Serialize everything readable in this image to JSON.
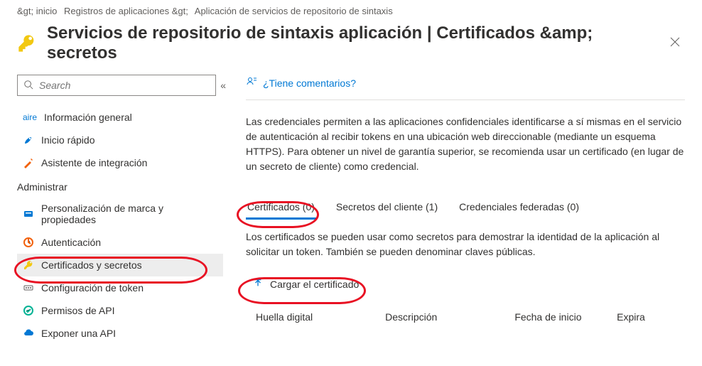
{
  "breadcrumb": {
    "home": "&gt; inicio",
    "registrations": "Registros de aplicaciones &gt;",
    "app": "Aplicación de servicios de repositorio de sintaxis"
  },
  "header": {
    "title": "Servicios de repositorio de sintaxis aplicación | Certificados &amp; secretos"
  },
  "search": {
    "placeholder": "Search"
  },
  "nav": {
    "overview": "Información general",
    "aire_prefix": "aire",
    "quickstart": "Inicio rápido",
    "integration_assistant": "Asistente de integración",
    "group_manage": "Administrar",
    "branding": "Personalización de marca y propiedades",
    "authentication": "Autenticación",
    "certificates_secrets": "Certificados y secretos",
    "token_config": "Configuración de token",
    "api_permissions": "Permisos de API",
    "expose_api": "Exponer una API"
  },
  "main": {
    "feedback": "¿Tiene comentarios?",
    "description": "Las credenciales permiten a las aplicaciones confidenciales identificarse a sí mismas en el servicio de autenticación al recibir tokens en una ubicación web direccionable (mediante un esquema HTTPS). Para obtener un nivel de garantía superior, se recomienda usar un certificado (en lugar de un secreto de cliente) como credencial.",
    "tabs": {
      "certificates": "Certificados (0)",
      "client_secrets": "Secretos del cliente (1)",
      "federated": "Credenciales federadas (0)"
    },
    "tab_desc": "Los certificados se pueden usar como secretos para demostrar la identidad de la aplicación al solicitar un token. También se pueden denominar claves públicas.",
    "upload": "Cargar el certificado",
    "columns": {
      "thumbprint": "Huella digital",
      "description": "Descripción",
      "start_date": "Fecha de inicio",
      "expires": "Expira"
    }
  }
}
